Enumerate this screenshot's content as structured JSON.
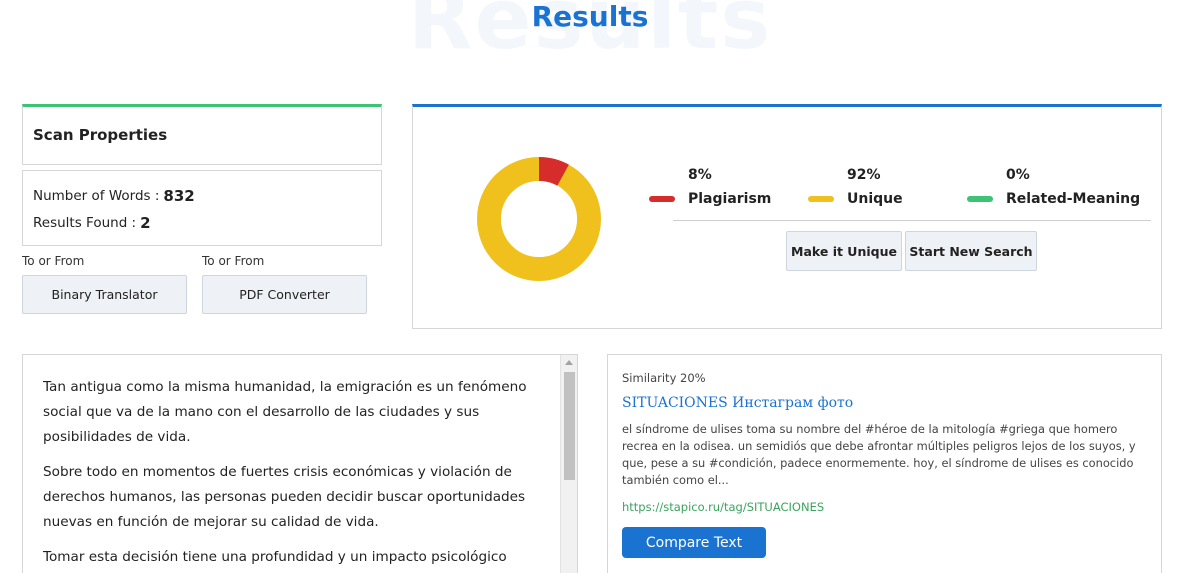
{
  "header": {
    "bg_word": "Results",
    "title": "Results"
  },
  "scan": {
    "title": "Scan Properties",
    "words_label": "Number of Words :",
    "words_value": "832",
    "results_label": "Results Found :",
    "results_value": "2"
  },
  "tools": [
    {
      "label": "To or From",
      "button": "Binary Translator"
    },
    {
      "label": "To or From",
      "button": "PDF Converter"
    }
  ],
  "result": {
    "legend": [
      {
        "pct": "8%",
        "label": "Plagiarism",
        "color": "#d62c2c"
      },
      {
        "pct": "92%",
        "label": "Unique",
        "color": "#f0c01c"
      },
      {
        "pct": "0%",
        "label": "Related-Meaning",
        "color": "#3ec276"
      }
    ],
    "donut": {
      "plagiarism": 8,
      "unique": 92,
      "related": 0
    },
    "make_unique": "Make it Unique",
    "start_new": "Start New Search"
  },
  "text": {
    "paragraphs": [
      "Tan antigua como la misma humanidad, la emigración es un fenómeno social que va de la mano con el desarrollo de las ciudades y sus posibilidades de vida.",
      "Sobre todo en momentos de fuertes crisis económicas y violación de derechos humanos, las personas pueden decidir buscar oportunidades nuevas en función de mejorar su calidad de vida.",
      "Tomar esta decisión tiene una profundidad y un impacto psicológico"
    ]
  },
  "source": {
    "similarity": "Similarity 20%",
    "title": "SITUACIONES Инстаграм фото",
    "excerpt": "el síndrome de ulises toma su nombre del #héroe de la mitología #griega que homero recrea en la odisea. un semidiós que debe afrontar múltiples peligros lejos de los suyos, y que, pese a su #condición, padece enormemente. hoy, el síndrome de ulises es conocido también como el...",
    "url": "https://stapico.ru/tag/SITUACIONES",
    "compare": "Compare Text"
  },
  "colors": {
    "accent": "#1a73d1",
    "green": "#3ec276",
    "red": "#d62c2c",
    "yellow": "#f0c01c"
  }
}
